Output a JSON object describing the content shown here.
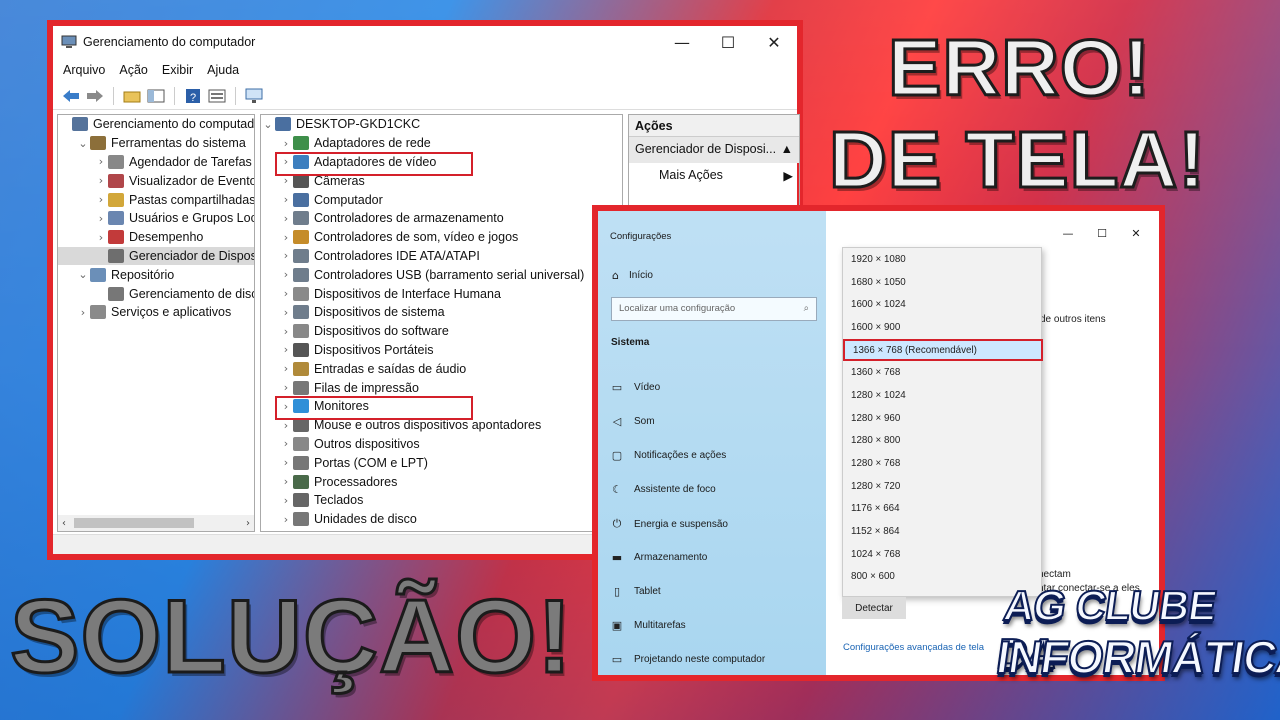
{
  "computer_management": {
    "title": "Gerenciamento do computador",
    "window_controls": [
      "—",
      "☐",
      "✕"
    ],
    "menu": [
      "Arquivo",
      "Ação",
      "Exibir",
      "Ajuda"
    ],
    "left_tree": [
      {
        "label": "Gerenciamento do computado",
        "indent": 0,
        "arrow": "",
        "icon": "computer-management-icon"
      },
      {
        "label": "Ferramentas do sistema",
        "indent": 1,
        "arrow": "⌄",
        "icon": "tools-icon"
      },
      {
        "label": "Agendador de Tarefas",
        "indent": 2,
        "arrow": "›",
        "icon": "clock-icon"
      },
      {
        "label": "Visualizador de Eventos",
        "indent": 2,
        "arrow": "›",
        "icon": "event-viewer-icon"
      },
      {
        "label": "Pastas compartilhadas",
        "indent": 2,
        "arrow": "›",
        "icon": "shared-folder-icon"
      },
      {
        "label": "Usuários e Grupos Loca",
        "indent": 2,
        "arrow": "›",
        "icon": "users-icon"
      },
      {
        "label": "Desempenho",
        "indent": 2,
        "arrow": "›",
        "icon": "performance-icon"
      },
      {
        "label": "Gerenciador de Disposit",
        "indent": 2,
        "arrow": "",
        "icon": "device-manager-icon",
        "selected": true
      },
      {
        "label": "Repositório",
        "indent": 1,
        "arrow": "⌄",
        "icon": "storage-icon"
      },
      {
        "label": "Gerenciamento de disco",
        "indent": 2,
        "arrow": "",
        "icon": "disk-icon"
      },
      {
        "label": "Serviços e aplicativos",
        "indent": 1,
        "arrow": "›",
        "icon": "services-icon"
      }
    ],
    "device_root": "DESKTOP-GKD1CKC",
    "devices": [
      {
        "label": "Adaptadores de rede",
        "icon": "network-adapter-icon"
      },
      {
        "label": "Adaptadores de vídeo",
        "icon": "display-adapter-icon",
        "highlight": true
      },
      {
        "label": "Câmeras",
        "icon": "camera-icon"
      },
      {
        "label": "Computador",
        "icon": "computer-icon"
      },
      {
        "label": "Controladores de armazenamento",
        "icon": "storage-controller-icon"
      },
      {
        "label": "Controladores de som, vídeo e jogos",
        "icon": "sound-icon"
      },
      {
        "label": "Controladores IDE ATA/ATAPI",
        "icon": "ide-icon"
      },
      {
        "label": "Controladores USB (barramento serial universal)",
        "icon": "usb-icon"
      },
      {
        "label": "Dispositivos de Interface Humana",
        "icon": "hid-icon"
      },
      {
        "label": "Dispositivos de sistema",
        "icon": "system-device-icon"
      },
      {
        "label": "Dispositivos do software",
        "icon": "software-device-icon"
      },
      {
        "label": "Dispositivos Portáteis",
        "icon": "portable-device-icon"
      },
      {
        "label": "Entradas e saídas de áudio",
        "icon": "audio-icon"
      },
      {
        "label": "Filas de impressão",
        "icon": "printer-icon"
      },
      {
        "label": "Monitores",
        "icon": "monitor-icon",
        "highlight": true
      },
      {
        "label": "Mouse e outros dispositivos apontadores",
        "icon": "mouse-icon"
      },
      {
        "label": "Outros dispositivos",
        "icon": "other-device-icon"
      },
      {
        "label": "Portas (COM e LPT)",
        "icon": "port-icon"
      },
      {
        "label": "Processadores",
        "icon": "processor-icon"
      },
      {
        "label": "Teclados",
        "icon": "keyboard-icon"
      },
      {
        "label": "Unidades de disco",
        "icon": "disk-drive-icon"
      }
    ],
    "actions": {
      "header": "Ações",
      "section": "Gerenciador de Disposi...",
      "more": "Mais Ações"
    }
  },
  "settings": {
    "title": "Configurações",
    "window_controls": [
      "—",
      "☐",
      "✕"
    ],
    "home": "Início",
    "search_placeholder": "Localizar uma configuração",
    "category": "Sistema",
    "nav": [
      {
        "label": "Vídeo",
        "icon": "display-icon"
      },
      {
        "label": "Som",
        "icon": "speaker-icon"
      },
      {
        "label": "Notificações e ações",
        "icon": "notification-icon"
      },
      {
        "label": "Assistente de foco",
        "icon": "moon-icon"
      },
      {
        "label": "Energia e suspensão",
        "icon": "power-icon"
      },
      {
        "label": "Armazenamento",
        "icon": "storage-icon"
      },
      {
        "label": "Tablet",
        "icon": "tablet-icon"
      },
      {
        "label": "Multitarefas",
        "icon": "multitask-icon"
      },
      {
        "label": "Projetando neste computador",
        "icon": "projecting-icon"
      }
    ],
    "resolutions": [
      "1920 × 1080",
      "1680 × 1050",
      "1600 × 1024",
      "1600 × 900",
      "1366 × 768 (Recomendável)",
      "1360 × 768",
      "1280 × 1024",
      "1280 × 960",
      "1280 × 800",
      "1280 × 768",
      "1280 × 720",
      "1176 × 664",
      "1152 × 864",
      "1024 × 768",
      "800 × 600"
    ],
    "selected_resolution": "1366 × 768 (Recomendável)",
    "bg_text_1": "de outros itens",
    "bg_text_2": "nectam",
    "bg_text_3": "ntar conectar-se a eles",
    "detect_button": "Detectar",
    "advanced_link": "Configurações avançadas de tela"
  },
  "overlay": {
    "line1": "ERRO!",
    "line2": "DE TELA!",
    "line3": "SOLUÇÃO!",
    "logo_line1": "AG CLUBE DA",
    "logo_line2": "INFORMÁTICA"
  },
  "colors": {
    "highlight_red": "#d4202a",
    "settings_sidebar": "#b4dbf2",
    "link_blue": "#1a64b4"
  }
}
